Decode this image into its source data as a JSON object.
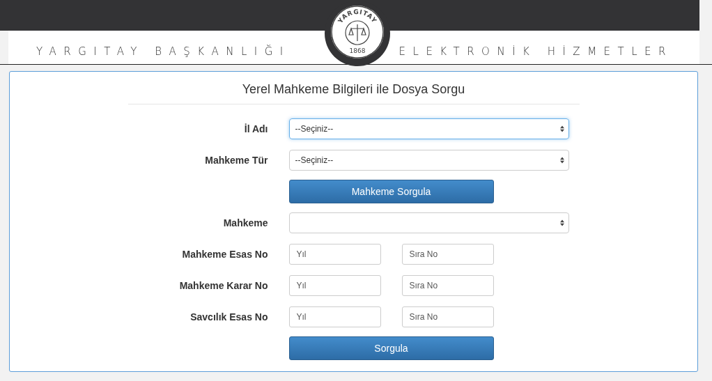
{
  "header": {
    "left_title": "YARGITAY BAŞKANLIĞI",
    "right_title": "ELEKTRONİK HİZMETLER",
    "emblem": {
      "ring_text": "YARGITAY",
      "year": "1868"
    }
  },
  "form": {
    "title": "Yerel Mahkeme Bilgileri ile Dosya Sorgu",
    "rows": [
      {
        "kind": "select",
        "label": "İl Adı",
        "value": "--Seçiniz--",
        "focused": true
      },
      {
        "kind": "select",
        "label": "Mahkeme Tür",
        "value": "--Seçiniz--",
        "focused": false
      },
      {
        "kind": "button",
        "label": "Mahkeme Sorgula"
      },
      {
        "kind": "select",
        "label": "Mahkeme",
        "focused": false
      },
      {
        "kind": "pair",
        "label": "Mahkeme Esas No",
        "placeholders": [
          "Yıl",
          "Sıra No"
        ]
      },
      {
        "kind": "pair",
        "label": "Mahkeme Karar No",
        "placeholders": [
          "Yıl",
          "Sıra No"
        ]
      },
      {
        "kind": "pair",
        "label": "Savcılık Esas No",
        "placeholders": [
          "Yıl",
          "Sıra No"
        ]
      },
      {
        "kind": "button",
        "label": "Sorgula"
      }
    ]
  }
}
